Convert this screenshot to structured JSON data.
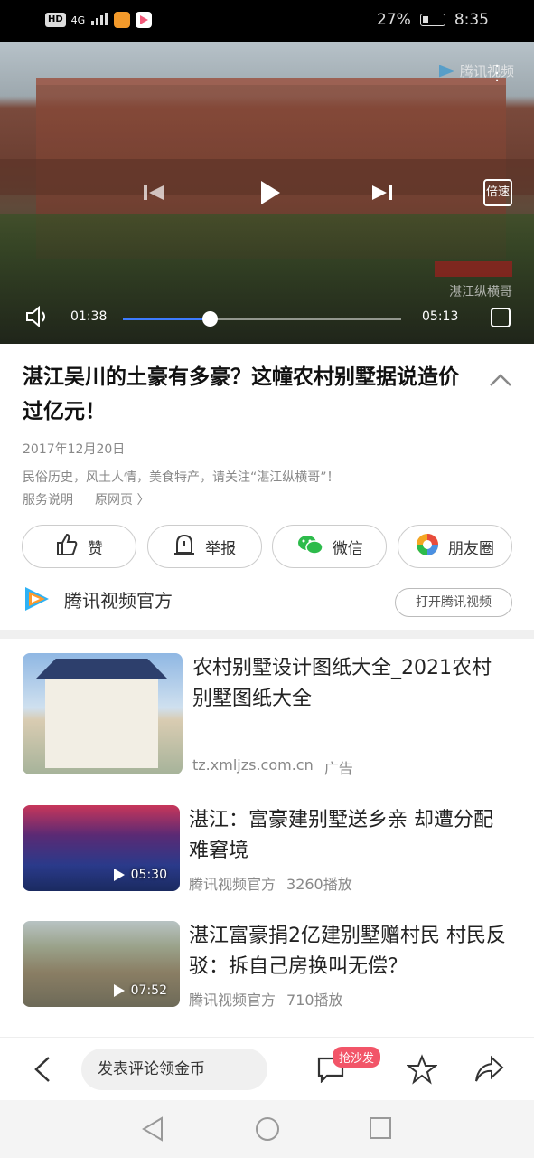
{
  "status": {
    "hd": "HD",
    "net": "4G",
    "battery": "27%",
    "time": "8:35"
  },
  "video": {
    "brand": "腾讯视频",
    "speed_label": "倍速",
    "watermark": "湛江纵横哥",
    "current_time": "01:38",
    "total_time": "05:13",
    "progress": 0.313
  },
  "article": {
    "title": "湛江吴川的土豪有多豪？这幢农村别墅据说造价过亿元！",
    "date": "2017年12月20日",
    "desc": "民俗历史，风土人情，美食特产，请关注“湛江纵横哥”！",
    "link_service": "服务说明",
    "link_original": "原网页 〉"
  },
  "actions": {
    "like": "赞",
    "report": "举报",
    "wechat": "微信",
    "moments": "朋友圈"
  },
  "source": {
    "name": "腾讯视频官方",
    "open_button": "打开腾讯视频"
  },
  "ad": {
    "title": "农村别墅设计图纸大全_2021农村别墅图纸大全",
    "domain": "tz.xmljzs.com.cn",
    "tag": "广告"
  },
  "related": [
    {
      "title": "湛江：富豪建别墅送乡亲 却遭分配难窘境",
      "duration": "05:30",
      "source": "腾讯视频官方",
      "plays": "3260播放"
    },
    {
      "title": "湛江富豪捐2亿建别墅赠村民 村民反驳：拆自己房换叫无偿？",
      "duration": "07:52",
      "source": "腾讯视频官方",
      "plays": "710播放"
    }
  ],
  "bottom": {
    "comment_placeholder": "发表评论领金币",
    "sofa_badge": "抢沙发"
  },
  "colors": {
    "accent": "#3d7bff",
    "badge": "#f25568"
  }
}
